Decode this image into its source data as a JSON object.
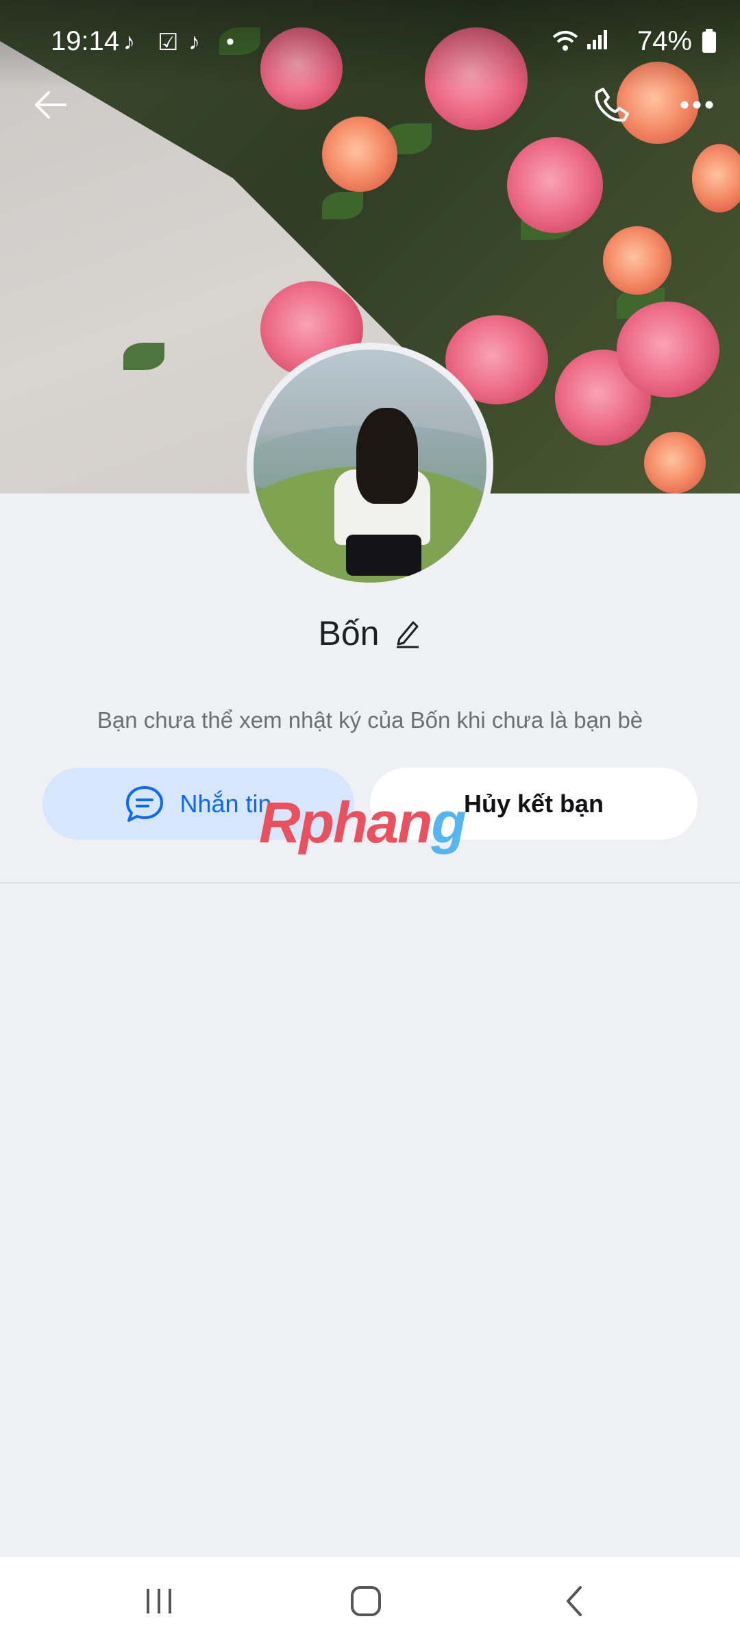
{
  "status_bar": {
    "time": "19:14",
    "battery": "74%"
  },
  "profile": {
    "name": "Bốn",
    "diary_notice": "Bạn chưa thể xem nhật ký của Bốn khi chưa là bạn bè"
  },
  "actions": {
    "message_label": "Nhắn tin",
    "unfriend_label": "Hủy kết bạn"
  },
  "watermark": {
    "part1": "Rphan",
    "part2": "g"
  },
  "colors": {
    "accent": "#0a68ff",
    "message_button_bg": "#d6e7fd",
    "page_bg": "#eff0f4"
  },
  "icons": {
    "back": "arrow-left-icon",
    "call": "phone-icon",
    "more": "more-dots-icon",
    "edit": "pencil-icon",
    "message": "chat-bubble-icon"
  }
}
